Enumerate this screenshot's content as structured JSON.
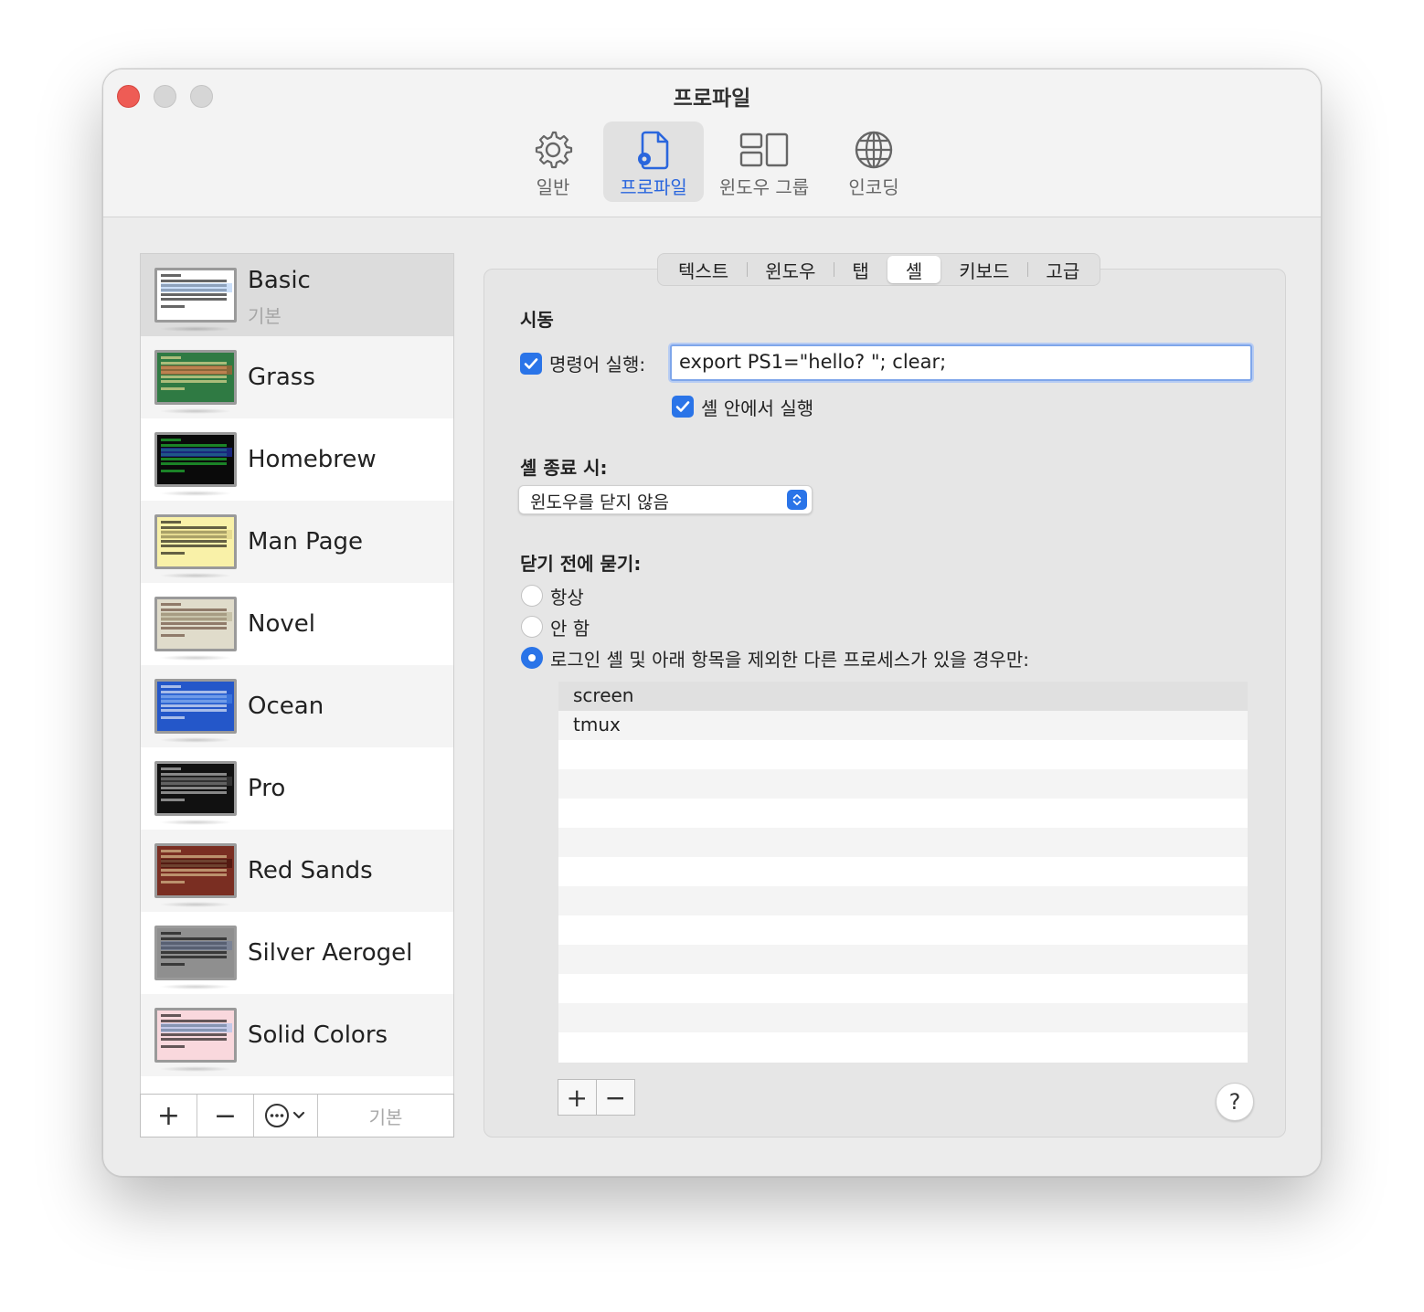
{
  "window": {
    "title": "프로파일"
  },
  "toolbar": {
    "items": [
      {
        "label": "일반",
        "icon": "gear-icon"
      },
      {
        "label": "프로파일",
        "icon": "profile-document-icon",
        "selected": true
      },
      {
        "label": "윈도우 그룹",
        "icon": "window-groups-icon"
      },
      {
        "label": "인코딩",
        "icon": "globe-icon"
      }
    ]
  },
  "sidebar": {
    "profiles": [
      {
        "name": "Basic",
        "subtitle": "기본",
        "bg": "#ffffff",
        "fg": "#000000",
        "accent": "#a9c9f5"
      },
      {
        "name": "Grass",
        "bg": "#2f7a43",
        "fg": "#ffe8a0",
        "accent": "#c85a34"
      },
      {
        "name": "Homebrew",
        "bg": "#0a0a0a",
        "fg": "#26d43b",
        "accent": "#2339c8"
      },
      {
        "name": "Man Page",
        "bg": "#f9f1a8",
        "fg": "#000000",
        "accent": "#d8cd82"
      },
      {
        "name": "Novel",
        "bg": "#e0dccb",
        "fg": "#5a3a2a",
        "accent": "#b8b295"
      },
      {
        "name": "Ocean",
        "bg": "#2457c9",
        "fg": "#ffffff",
        "accent": "#4a86e8"
      },
      {
        "name": "Pro",
        "bg": "#111111",
        "fg": "#d8d8d8",
        "accent": "#4a4a4a"
      },
      {
        "name": "Red Sands",
        "bg": "#7a2e22",
        "fg": "#e6d4a0",
        "accent": "#3a0e08"
      },
      {
        "name": "Silver Aerogel",
        "bg": "#8f8f8f",
        "fg": "#000000",
        "accent": "#6e7b9a"
      },
      {
        "name": "Solid Colors",
        "bg": "#f9d8dd",
        "fg": "#000000",
        "accent": "#9ec0f0"
      }
    ],
    "selected": "Basic",
    "buttons": {
      "add": "+",
      "remove": "−",
      "more_icon": "ellipsis-circle-icon",
      "default": "기본"
    }
  },
  "tabs": {
    "items": [
      "텍스트",
      "윈도우",
      "탭",
      "셸",
      "키보드",
      "고급"
    ],
    "active": "셸"
  },
  "shell": {
    "startup_title": "시동",
    "run_command_label": "명령어 실행:",
    "run_command_checked": true,
    "run_command_value": "export PS1=\"hello? \"; clear;",
    "run_inside_shell_label": "셸 안에서 실행",
    "run_inside_shell_checked": true,
    "on_exit_title": "셸 종료 시:",
    "on_exit_selected": "윈도우를 닫지 않음",
    "ask_before_closing_title": "닫기 전에 묻기:",
    "ask_options": [
      {
        "label": "항상",
        "selected": false
      },
      {
        "label": "안 함",
        "selected": false
      },
      {
        "label": "로그인 셸 및 아래 항목을 제외한 다른 프로세스가 있을 경우만:",
        "selected": true
      }
    ],
    "processes": [
      "screen",
      "tmux"
    ],
    "process_add": "+",
    "process_remove": "−",
    "help": "?"
  },
  "colors": {
    "accent": "#2a74e8",
    "toolbar_selected": "#2a66dd",
    "close_button": "#ee5c55"
  }
}
